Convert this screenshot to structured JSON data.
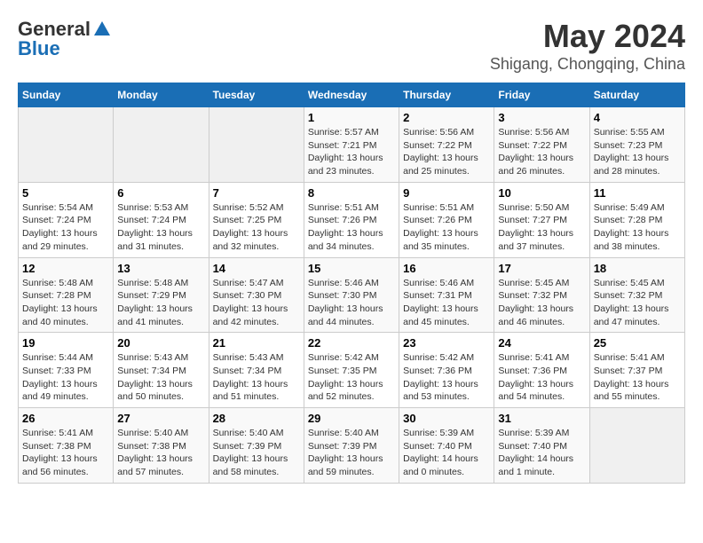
{
  "header": {
    "logo_line1": "General",
    "logo_line2": "Blue",
    "title": "May 2024",
    "subtitle": "Shigang, Chongqing, China"
  },
  "weekdays": [
    "Sunday",
    "Monday",
    "Tuesday",
    "Wednesday",
    "Thursday",
    "Friday",
    "Saturday"
  ],
  "weeks": [
    [
      {
        "day": "",
        "info": ""
      },
      {
        "day": "",
        "info": ""
      },
      {
        "day": "",
        "info": ""
      },
      {
        "day": "1",
        "info": "Sunrise: 5:57 AM\nSunset: 7:21 PM\nDaylight: 13 hours\nand 23 minutes."
      },
      {
        "day": "2",
        "info": "Sunrise: 5:56 AM\nSunset: 7:22 PM\nDaylight: 13 hours\nand 25 minutes."
      },
      {
        "day": "3",
        "info": "Sunrise: 5:56 AM\nSunset: 7:22 PM\nDaylight: 13 hours\nand 26 minutes."
      },
      {
        "day": "4",
        "info": "Sunrise: 5:55 AM\nSunset: 7:23 PM\nDaylight: 13 hours\nand 28 minutes."
      }
    ],
    [
      {
        "day": "5",
        "info": "Sunrise: 5:54 AM\nSunset: 7:24 PM\nDaylight: 13 hours\nand 29 minutes."
      },
      {
        "day": "6",
        "info": "Sunrise: 5:53 AM\nSunset: 7:24 PM\nDaylight: 13 hours\nand 31 minutes."
      },
      {
        "day": "7",
        "info": "Sunrise: 5:52 AM\nSunset: 7:25 PM\nDaylight: 13 hours\nand 32 minutes."
      },
      {
        "day": "8",
        "info": "Sunrise: 5:51 AM\nSunset: 7:26 PM\nDaylight: 13 hours\nand 34 minutes."
      },
      {
        "day": "9",
        "info": "Sunrise: 5:51 AM\nSunset: 7:26 PM\nDaylight: 13 hours\nand 35 minutes."
      },
      {
        "day": "10",
        "info": "Sunrise: 5:50 AM\nSunset: 7:27 PM\nDaylight: 13 hours\nand 37 minutes."
      },
      {
        "day": "11",
        "info": "Sunrise: 5:49 AM\nSunset: 7:28 PM\nDaylight: 13 hours\nand 38 minutes."
      }
    ],
    [
      {
        "day": "12",
        "info": "Sunrise: 5:48 AM\nSunset: 7:28 PM\nDaylight: 13 hours\nand 40 minutes."
      },
      {
        "day": "13",
        "info": "Sunrise: 5:48 AM\nSunset: 7:29 PM\nDaylight: 13 hours\nand 41 minutes."
      },
      {
        "day": "14",
        "info": "Sunrise: 5:47 AM\nSunset: 7:30 PM\nDaylight: 13 hours\nand 42 minutes."
      },
      {
        "day": "15",
        "info": "Sunrise: 5:46 AM\nSunset: 7:30 PM\nDaylight: 13 hours\nand 44 minutes."
      },
      {
        "day": "16",
        "info": "Sunrise: 5:46 AM\nSunset: 7:31 PM\nDaylight: 13 hours\nand 45 minutes."
      },
      {
        "day": "17",
        "info": "Sunrise: 5:45 AM\nSunset: 7:32 PM\nDaylight: 13 hours\nand 46 minutes."
      },
      {
        "day": "18",
        "info": "Sunrise: 5:45 AM\nSunset: 7:32 PM\nDaylight: 13 hours\nand 47 minutes."
      }
    ],
    [
      {
        "day": "19",
        "info": "Sunrise: 5:44 AM\nSunset: 7:33 PM\nDaylight: 13 hours\nand 49 minutes."
      },
      {
        "day": "20",
        "info": "Sunrise: 5:43 AM\nSunset: 7:34 PM\nDaylight: 13 hours\nand 50 minutes."
      },
      {
        "day": "21",
        "info": "Sunrise: 5:43 AM\nSunset: 7:34 PM\nDaylight: 13 hours\nand 51 minutes."
      },
      {
        "day": "22",
        "info": "Sunrise: 5:42 AM\nSunset: 7:35 PM\nDaylight: 13 hours\nand 52 minutes."
      },
      {
        "day": "23",
        "info": "Sunrise: 5:42 AM\nSunset: 7:36 PM\nDaylight: 13 hours\nand 53 minutes."
      },
      {
        "day": "24",
        "info": "Sunrise: 5:41 AM\nSunset: 7:36 PM\nDaylight: 13 hours\nand 54 minutes."
      },
      {
        "day": "25",
        "info": "Sunrise: 5:41 AM\nSunset: 7:37 PM\nDaylight: 13 hours\nand 55 minutes."
      }
    ],
    [
      {
        "day": "26",
        "info": "Sunrise: 5:41 AM\nSunset: 7:38 PM\nDaylight: 13 hours\nand 56 minutes."
      },
      {
        "day": "27",
        "info": "Sunrise: 5:40 AM\nSunset: 7:38 PM\nDaylight: 13 hours\nand 57 minutes."
      },
      {
        "day": "28",
        "info": "Sunrise: 5:40 AM\nSunset: 7:39 PM\nDaylight: 13 hours\nand 58 minutes."
      },
      {
        "day": "29",
        "info": "Sunrise: 5:40 AM\nSunset: 7:39 PM\nDaylight: 13 hours\nand 59 minutes."
      },
      {
        "day": "30",
        "info": "Sunrise: 5:39 AM\nSunset: 7:40 PM\nDaylight: 14 hours\nand 0 minutes."
      },
      {
        "day": "31",
        "info": "Sunrise: 5:39 AM\nSunset: 7:40 PM\nDaylight: 14 hours\nand 1 minute."
      },
      {
        "day": "",
        "info": ""
      }
    ]
  ]
}
